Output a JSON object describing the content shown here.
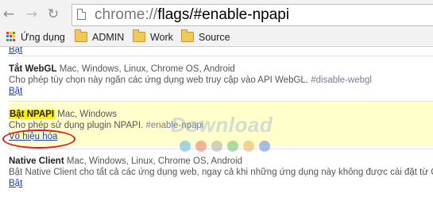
{
  "toolbar": {
    "url_scheme": "chrome://",
    "url_path": "flags/#enable-npapi"
  },
  "bookmarks": [
    {
      "label": "Ứng dụng"
    },
    {
      "label": "ADMIN"
    },
    {
      "label": "Work"
    },
    {
      "label": "Source"
    }
  ],
  "flags": {
    "top_link": "Bật",
    "webgl": {
      "name": "Tắt WebGL",
      "platforms": "Mac, Windows, Linux, Chrome OS, Android",
      "desc": "Cho phép tùy chọn này ngăn các ứng dụng web truy cập vào API WebGL.",
      "anchor": "#disable-webgl",
      "action": "Bật"
    },
    "npapi": {
      "name": "Bật NPAPI",
      "platforms": "Mac, Windows",
      "desc": "Cho phép sử dụng plugin NPAPI.",
      "anchor": "#enable-npapi",
      "action": "Vô hiệu hóa"
    },
    "nacl": {
      "name": "Native Client",
      "platforms": "Mac, Windows, Linux, Chrome OS, Android",
      "desc": "Bật Native Client cho tất cả các ứng dụng web, ngay cả khi những ứng dụng này không được cài đặt từ Cửa hàng",
      "action": "Bật"
    }
  },
  "watermark": "Download",
  "colors": {
    "highlight": "#fff200",
    "row_highlight": "#ffffcc",
    "link": "#1a3fb5",
    "annotation": "#d71e1e"
  }
}
